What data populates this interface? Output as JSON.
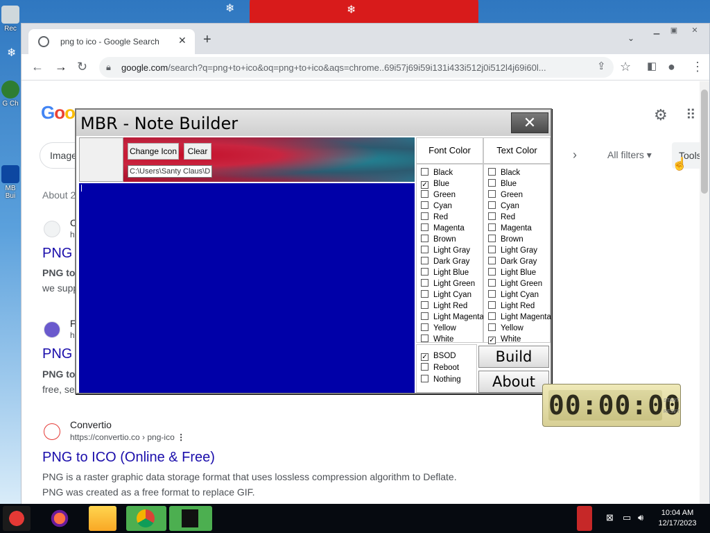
{
  "browser": {
    "tab_title": "png to ico - Google Search",
    "url_domain": "google.com",
    "url_rest": "/search?q=png+to+ico&oq=png+to+ico&aqs=chrome..69i57j69i59i131i433i512j0i512l4j69i60l...",
    "new_tab": "+",
    "tab_close": "✕",
    "tabs_dropdown": "⌄"
  },
  "search": {
    "tab_images": "Image",
    "all_filters": "All filters",
    "tools": "Tools",
    "about": "About 2",
    "results": [
      {
        "site": "C",
        "cite": "h",
        "title": "PNG",
        "snippet1": "PNG to",
        "snippet2": "we supp"
      },
      {
        "site": "F",
        "cite": "h",
        "title": "PNG",
        "snippet1": "PNG to",
        "snippet2": "free, se"
      },
      {
        "site": "Convertio",
        "cite": "https://convertio.co › png-ico",
        "title": "PNG to ICO (Online & Free)",
        "snippet1": "PNG is a raster graphic data storage format that uses lossless compression algorithm to Deflate.",
        "snippet2": "PNG was created as a free format to replace GIF."
      }
    ]
  },
  "mbr": {
    "title": "MBR - Note Builder",
    "close": "✕",
    "change_icon": "Change Icon",
    "clear": "Clear",
    "path": "C:\\Users\\Santy Claus\\D",
    "font_color_header": "Font Color",
    "text_color_header": "Text Color",
    "colors": [
      "Black",
      "Blue",
      "Green",
      "Cyan",
      "Red",
      "Magenta",
      "Brown",
      "Light Gray",
      "Dark Gray",
      "Light Blue",
      "Light Green",
      "Light Cyan",
      "Light Red",
      "Light Magenta",
      "Yellow",
      "White"
    ],
    "font_color_checked": "Blue",
    "text_color_checked": "White",
    "actions": [
      "BSOD",
      "Reboot",
      "Nothing"
    ],
    "action_checked": "BSOD",
    "build": "Build",
    "about": "About",
    "editor_bg": "#0000a8"
  },
  "timer": {
    "display": "00:00:00",
    "start": "START",
    "reset": "RESET"
  },
  "taskbar": {
    "time": "10:04 AM",
    "date": "12/17/2023"
  },
  "desktop": {
    "icon1": "Rec",
    "icon2": "G Ch",
    "icon3": "MB Bui"
  }
}
